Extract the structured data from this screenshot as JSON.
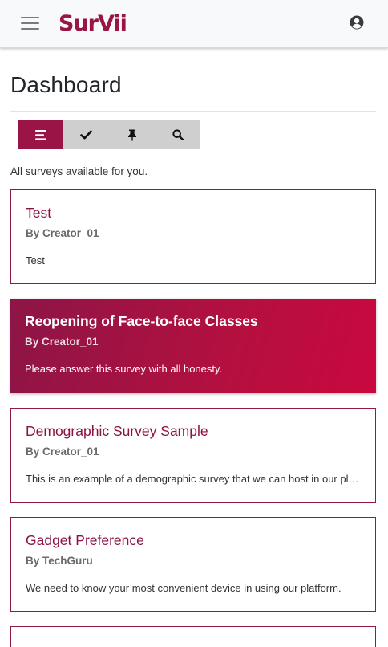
{
  "nav": {
    "brand": "SurVii",
    "brand_color": "#9a1446",
    "menu_icon": "hamburger-icon",
    "user_icon": "user-circle-icon"
  },
  "page": {
    "title": "Dashboard",
    "subtitle": "All surveys available for you."
  },
  "tabs": [
    {
      "icon": "list-icon",
      "active": true
    },
    {
      "icon": "check-icon",
      "active": false
    },
    {
      "icon": "pin-icon",
      "active": false
    },
    {
      "icon": "search-icon",
      "active": false
    }
  ],
  "surveys": [
    {
      "title": "Test",
      "author": "By Creator_01",
      "description": "Test"
    },
    {
      "title": "Reopening of Face-to-face Classes",
      "author": "By Creator_01",
      "description": "Please answer this survey with all honesty."
    },
    {
      "title": "Demographic Survey Sample",
      "author": "By Creator_01",
      "description": "This is an example of a demographic survey that we can host in our platform."
    },
    {
      "title": "Gadget Preference",
      "author": "By TechGuru",
      "description": "We need to know your most convenient device in using our platform."
    }
  ],
  "colors": {
    "accent": "#9a1446",
    "card_border": "#8f1a48",
    "tab_inactive": "#cfcfcf"
  }
}
